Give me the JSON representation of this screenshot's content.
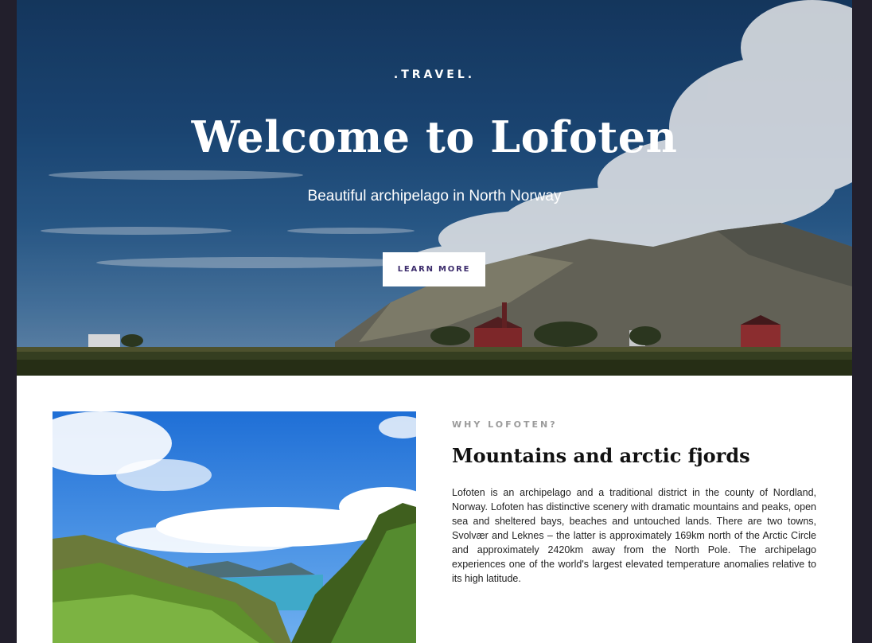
{
  "hero": {
    "eyebrow": ".TRAVEL.",
    "title": "Welcome to Lofoten",
    "subtitle": "Beautiful archipelago in North Norway",
    "button_label": "LEARN MORE"
  },
  "about": {
    "eyebrow": "WHY LOFOTEN?",
    "title": "Mountains and arctic fjords",
    "body": "Lofoten is an archipelago and a traditional district in the county of Nordland, Norway. Lofoten has distinctive scenery with dramatic mountains and peaks, open sea and sheltered bays, beaches and untouched lands. There are two towns, Svolvær and Leknes – the latter is approximately 169km north of the Arctic Circle and approximately 2420km away from the North Pole. The archipelago experiences one of the world's largest elevated temperature anomalies relative to its high latitude."
  },
  "colors": {
    "frame": "#221f2c",
    "button_text": "#3b2b6b",
    "eyebrow_gray": "#9b9b9b"
  }
}
